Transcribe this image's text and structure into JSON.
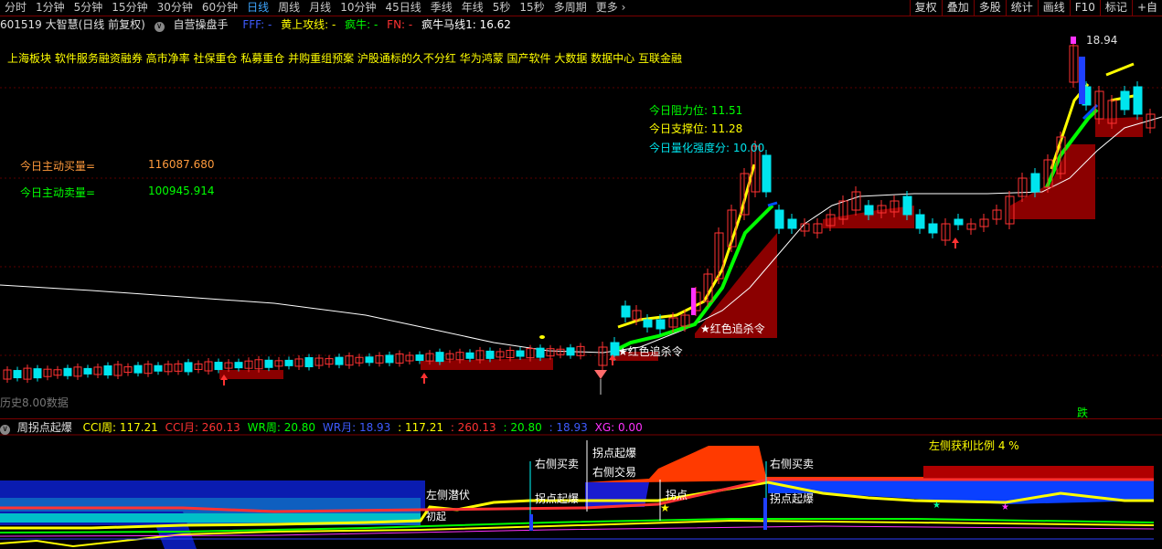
{
  "period_tabs": [
    "分时",
    "1分钟",
    "5分钟",
    "15分钟",
    "30分钟",
    "60分钟",
    "日线",
    "周线",
    "月线",
    "10分钟",
    "45日线",
    "季线",
    "年线",
    "5秒",
    "15秒",
    "多周期",
    "更多"
  ],
  "active_tab": "日线",
  "right_tools": [
    "复权",
    "叠加",
    "多股",
    "统计",
    "画线",
    "F10",
    "标记",
    "+自"
  ],
  "info": {
    "stock": "601519 大智慧(日线 前复权)",
    "formula": "自营操盘手",
    "fff": "FFF: -",
    "yellow_line": "黄上攻线: -",
    "crazy_bull": "疯牛: -",
    "fn": "FN: -",
    "crazy_horse": "疯牛马线1: 16.62"
  },
  "sectors": "上海板块  软件服务融资融券 高市净率 社保重仓 私募重仓 并购重组预案 沪股通标的久不分红  华为鸿蒙 国产软件 大数据 数据中心 互联金融",
  "active_buy_label": "今日主动买量=",
  "active_buy_value": "116087.680",
  "active_sell_label": "今日主动卖量=",
  "active_sell_value": "100945.914",
  "resistance": "今日阻力位:  11.51",
  "support": "今日支撑位:  11.28",
  "strength": "今日量化强度分:  10.00",
  "high_label": "18.94",
  "signal1": "★红色追杀令",
  "signal2": "★红色追杀令",
  "bottom_left_text": "历史8.00数据",
  "fall_mark": "跌",
  "indicator": {
    "name": "周拐点起爆",
    "cci_week": "CCI周: 117.21",
    "cci_month": "CCI月: 260.13",
    "wr_week": "WR周: 20.80",
    "wr_month": "WR月: 18.93",
    "v1": ": 117.21",
    "v2": ": 260.13",
    "v3": ": 20.80",
    "v4": ": 18.93",
    "xg": "XG: 0.00"
  },
  "ind_labels": {
    "left_lurk": "左侧潜伏",
    "start": "初起",
    "pivot_burst1": "拐点起爆",
    "right_buy1": "右侧买卖",
    "pivot_burst2": "拐点起爆",
    "right_trade": "右侧交易",
    "pivot": "拐点",
    "right_buy2": "右侧买卖",
    "pivot_burst3": "拐点起爆",
    "profit_ratio": "左侧获利比例 4 %"
  },
  "colors": {
    "up": "#ff3232",
    "down": "#00e5ee",
    "ma": "#ffffff",
    "yellow": "#ffff00",
    "green": "#00ff00",
    "blue": "#0050ff",
    "fill": "#8b0000"
  }
}
